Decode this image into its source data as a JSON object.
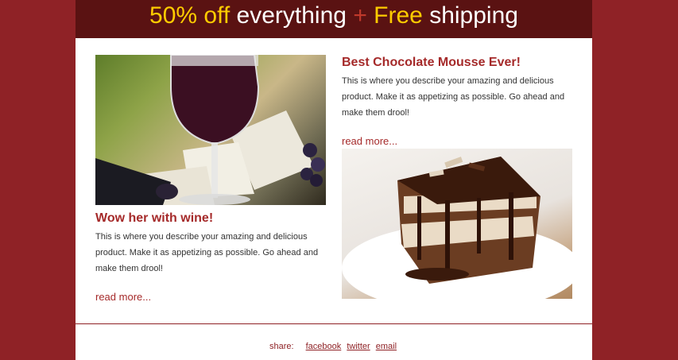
{
  "banner": {
    "part1": "50% off",
    "part2": " everything ",
    "part3": "+",
    "part4": " Free",
    "part5": " shipping"
  },
  "product_wine": {
    "title": "Wow her with wine!",
    "description": "This is where you describe your amazing and delicious product. Make it as appetizing as possible.  Go ahead and make them drool!",
    "read_more": "read more..."
  },
  "product_mousse": {
    "title": "Best Chocolate Mousse Ever!",
    "description": "This is where you describe your amazing and delicious product. Make it as appetizing as possible.  Go ahead and make them drool!",
    "read_more": "read more..."
  },
  "footer": {
    "share_label": "share:",
    "links": [
      "facebook",
      "twitter",
      "email"
    ]
  },
  "colors": {
    "background": "#8f2226",
    "banner": "#5a1212",
    "accent_yellow": "#ffcc00",
    "heading": "#a52a2a"
  }
}
